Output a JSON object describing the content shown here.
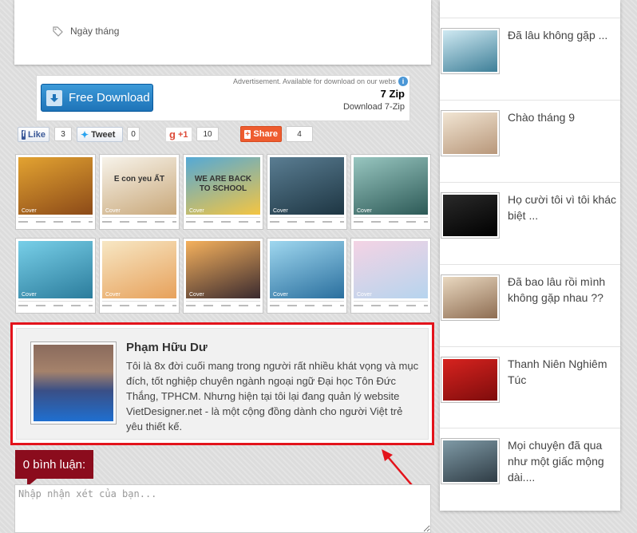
{
  "post": {
    "tag_label": "Ngày tháng"
  },
  "ad": {
    "button_label": "Free Download",
    "note": "Advertisement. Available for download on our webs",
    "title": "7 Zip",
    "subtitle": "Download 7-Zip"
  },
  "share": {
    "fb_label": "Like",
    "fb_count": "3",
    "tw_label": "Tweet",
    "tw_count": "0",
    "gp_label": "+1",
    "gp_count": "10",
    "share_label": "Share",
    "share_count": "4"
  },
  "related": [
    {
      "overlay": "",
      "colors": [
        "#e3a331",
        "#8c4a18"
      ]
    },
    {
      "overlay": "E con yeu ẤT",
      "colors": [
        "#f7f3ea",
        "#c9a87a"
      ]
    },
    {
      "overlay": "WE ARE BACK TO SCHOOL",
      "colors": [
        "#54a9d6",
        "#f4c542"
      ]
    },
    {
      "overlay": "",
      "colors": [
        "#5a7d92",
        "#1e3643"
      ]
    },
    {
      "overlay": "",
      "colors": [
        "#98c6c0",
        "#2d5a57"
      ]
    },
    {
      "overlay": "",
      "colors": [
        "#78cfe8",
        "#2b7c9c"
      ]
    },
    {
      "overlay": "",
      "colors": [
        "#f7e7c4",
        "#e7a15b"
      ]
    },
    {
      "overlay": "",
      "colors": [
        "#f5b15d",
        "#3a2a2f"
      ]
    },
    {
      "overlay": "",
      "colors": [
        "#9fd7ef",
        "#2a6f9e"
      ]
    },
    {
      "overlay": "",
      "colors": [
        "#f4d3e4",
        "#b6d4ee"
      ]
    }
  ],
  "thumb_caption": "Cover",
  "author": {
    "name": "Phạm Hữu Dư",
    "bio": "Tôi là 8x đời cuối mang trong người rất nhiều khát vọng và mục đích, tốt nghiệp chuyên ngành ngoại ngữ Đại học Tôn Đức Thắng, TPHCM. Nhưng hiện tại tôi lại đang quản lý website VietDesigner.net - là một cộng đồng dành cho người Việt trẻ yêu thiết kế."
  },
  "comments": {
    "count_label": "0 bình luận:",
    "placeholder": "Nhập nhận xét của bạn..."
  },
  "sidebar": {
    "items": [
      {
        "title": "Đã lâu không gặp ...",
        "colors": [
          "#cfe9f2",
          "#3e7f98"
        ]
      },
      {
        "title": "Chào tháng 9",
        "colors": [
          "#f1e5d3",
          "#b8977a"
        ]
      },
      {
        "title": "Họ cười tôi vì tôi khác biệt ...",
        "colors": [
          "#2a2a2a",
          "#000000"
        ]
      },
      {
        "title": "Đã bao lâu rồi mình không gặp nhau ??",
        "colors": [
          "#e9d8c0",
          "#8e6d52"
        ]
      },
      {
        "title": "Thanh Niên Nghiêm Túc",
        "colors": [
          "#d7231f",
          "#7e0c0c"
        ]
      },
      {
        "title": "Mọi chuyện đã qua như một giấc mộng dài....",
        "colors": [
          "#7f9aa6",
          "#2f3c45"
        ]
      }
    ]
  },
  "colors": {
    "highlight": "#e3131b",
    "comment_tag": "#8b0c1d",
    "ad_button": "#1e73b8"
  }
}
